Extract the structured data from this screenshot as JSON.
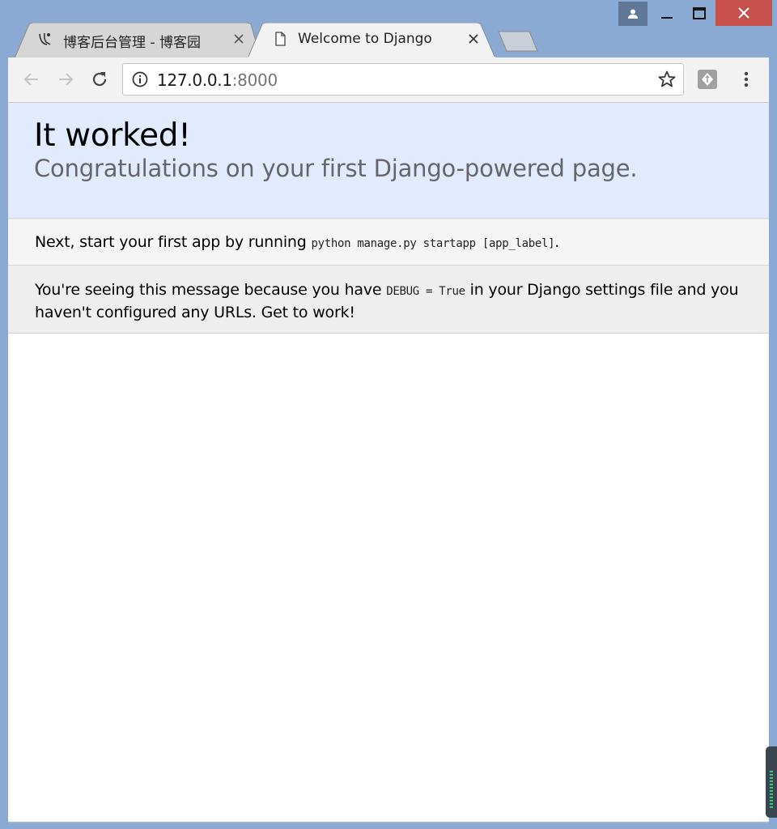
{
  "window": {
    "controls": [
      "profile-icon",
      "minimize-icon",
      "maximize-icon",
      "close-icon"
    ]
  },
  "tabs": [
    {
      "title": "博客后台管理 - 博客园",
      "icon": "cnblogs-logo-icon",
      "active": false
    },
    {
      "title": "Welcome to Django",
      "icon": "document-icon",
      "active": true
    }
  ],
  "toolbar": {
    "url_host": "127.0.0.1",
    "url_port": ":8000"
  },
  "page": {
    "heading": "It worked!",
    "subtitle": "Congratulations on your first Django-powered page.",
    "instructions": {
      "prefix": "Next, start your first app by running ",
      "command": "python manage.py startapp [app_label]",
      "suffix": "."
    },
    "explanation": {
      "prefix": "You're seeing this message because you have ",
      "code": "DEBUG = True",
      "suffix": " in your Django settings file and you haven't configured any URLs. Get to work!"
    }
  },
  "colors": {
    "summary_bg": "#e1eaff",
    "instructions_bg": "#f5f5f5",
    "explanation_bg": "#eeeeee",
    "close_button": "#c7504d",
    "window_frame": "#8aa9d3"
  }
}
